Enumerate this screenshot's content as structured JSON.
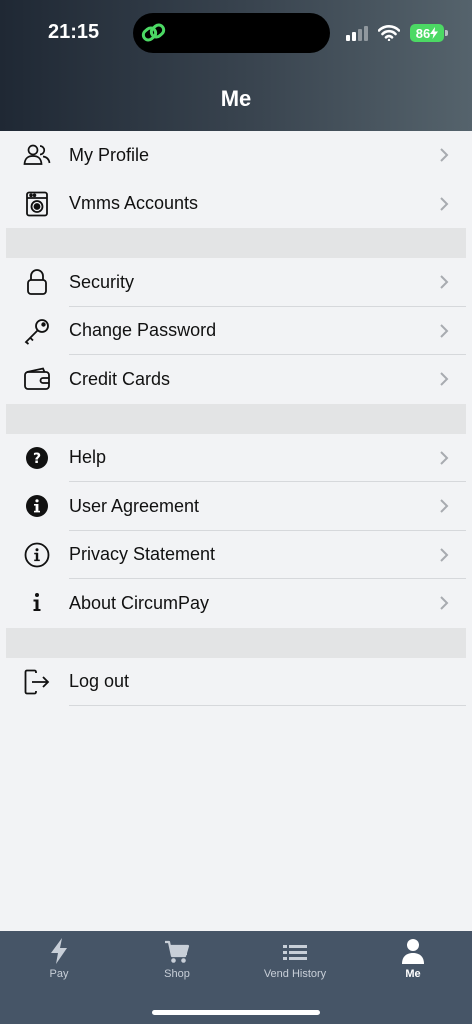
{
  "status_bar": {
    "time": "21:15",
    "battery": "86"
  },
  "header": {
    "title": "Me"
  },
  "menu": {
    "group1": [
      {
        "label": "My Profile",
        "icon": "users-icon"
      },
      {
        "label": "Vmms Accounts",
        "icon": "washing-machine-icon"
      }
    ],
    "group2": [
      {
        "label": "Security",
        "icon": "lock-icon"
      },
      {
        "label": "Change Password",
        "icon": "key-icon"
      },
      {
        "label": "Credit Cards",
        "icon": "wallet-icon"
      }
    ],
    "group3": [
      {
        "label": "Help",
        "icon": "help-icon"
      },
      {
        "label": "User Agreement",
        "icon": "info-filled-icon"
      },
      {
        "label": "Privacy Statement",
        "icon": "info-outline-icon"
      },
      {
        "label": "About CircumPay",
        "icon": "info-icon"
      }
    ],
    "group4": [
      {
        "label": "Log out",
        "icon": "logout-icon"
      }
    ]
  },
  "tabbar": {
    "tabs": [
      {
        "label": "Pay",
        "icon": "bolt-icon"
      },
      {
        "label": "Shop",
        "icon": "cart-icon"
      },
      {
        "label": "Vend History",
        "icon": "list-icon"
      },
      {
        "label": "Me",
        "icon": "person-icon",
        "active": true
      }
    ]
  },
  "colors": {
    "header_dark": "#1f2834",
    "tabbar": "#465567",
    "battery": "#4cd964",
    "background": "#f2f3f5"
  }
}
